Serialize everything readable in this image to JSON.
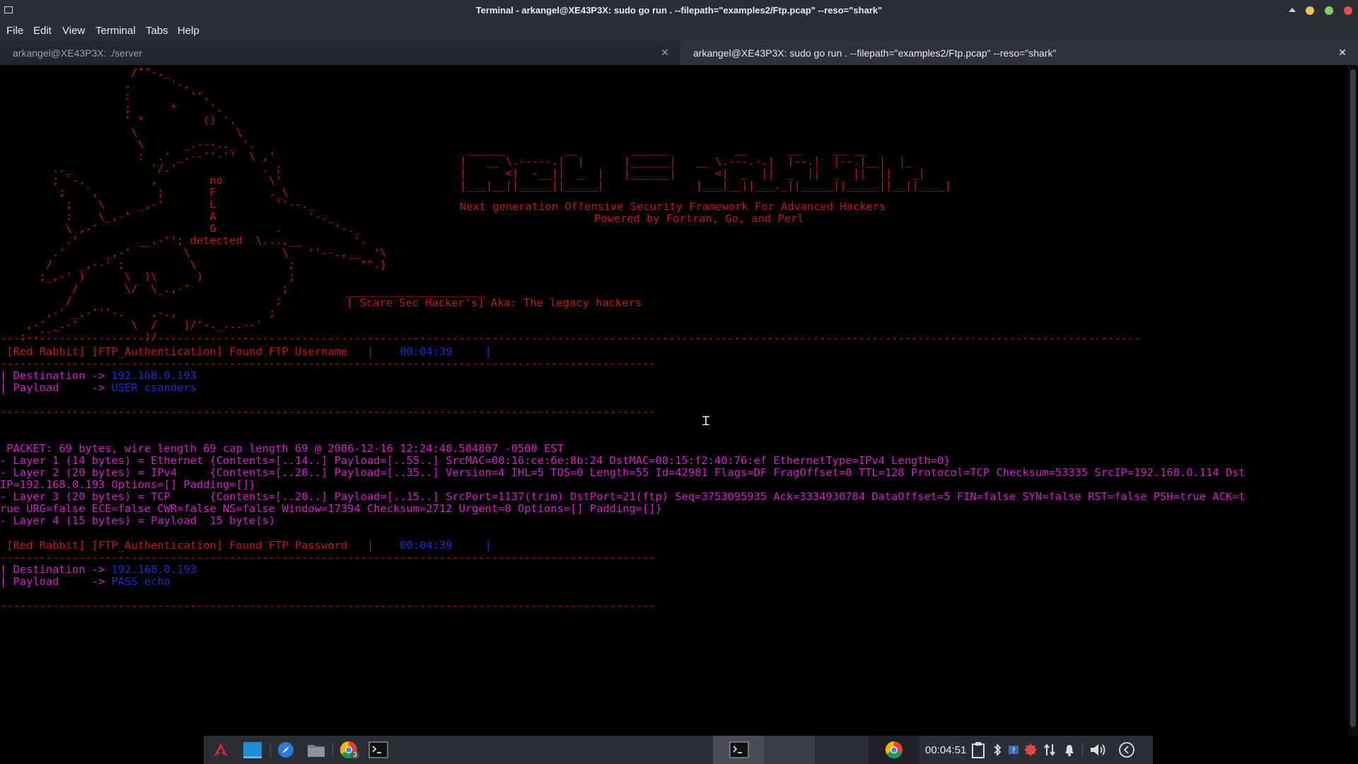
{
  "window": {
    "title": "Terminal - arkangel@XE43P3X: sudo go run . --filepath=\"examples2/Ftp.pcap\" --reso=\"shark\"",
    "controls": [
      "maximize-up-icon",
      "minimize-icon",
      "restore-icon",
      "close-icon"
    ],
    "colors": {
      "min": "#f5c14b",
      "max": "#7ad06b",
      "close": "#e35050"
    }
  },
  "menu": {
    "items": [
      "File",
      "Edit",
      "View",
      "Terminal",
      "Tabs",
      "Help"
    ]
  },
  "tabs": [
    {
      "label": "arkangel@XE43P3X: ./server",
      "active": false
    },
    {
      "label": "arkangel@XE43P3X: sudo go run . --filepath=\"examples2/Ftp.pcap\" --reso=\"shark\"",
      "active": true
    }
  ],
  "terminal": {
    "ascii_art": [
      "                    /\"\"-._",
      "                   .      '-,",
      "                   :         '',",
      "                   ;      *     '.",
      "                   ' *         () '.",
      "                    \\               \\",
      "                     \\      _.---.._ '.",
      "                     :  .' _.--''-''  \\ ,'",
      "        .._            '/.'             . ;",
      "        ; `-.          ,        no       \\'",
      "         ;   `,         ;       F        ._\\",
      "          ;    \\     _,-'       L         ''--._",
      "          :    \\_,-'            A              '-._",
      "          \\ ,-'                 G         .        '-._",
      "          .'         __.-''; detected  \\...,__        '.",
      "        .'      _,-'        \\              \\   ''--.,__  '\\",
      "       /    _,--' ;          \\              ;          \"^.}",
      "      ;_,-' )      \\  )\\      )             ;",
      "           /       \\/  \\_.,-'              ;",
      "          /                               ;",
      "       ,-' _,-'''-.    ,-.,              ;",
      "    ,-' _.-'        \\  /    |/'-._...--'",
      "   :--``              )/"
    ],
    "banner_logo": [
      " ______         __        ______          __      __     __ __",
      "|   __ \\.-----.|  |      |______|   __ \\.---.-.|  |--.|  |--.|__|  |_",
      "|      <|  -__||  _  |   |______|      <|  _  ||  _  ||  _  ||  ||   _|",
      "|___|__||_____||_____|              |___|__||___._||_____||_____||__||____|"
    ],
    "tagline": "Next generation Offensive Security Framework For Advanced Hackers",
    "powered": "Powered by Fortran, Go, and Perl",
    "credit_line": "_____________________",
    "credit": "[ Scare Sec Hacker's] Aka: The legacy hackers",
    "dashes_long": "------------------------------------------------------------------------------------------------------------------------------------------------------------------------------",
    "dashes_short": "----------------------------------------------------------------------------------------------------",
    "event1": {
      "head": " [Red Rabbit] [FTP_Authentication] Found FTP Username   |",
      "time": "00:04:39",
      "tail": "     |",
      "dest_label": "| Destination -> ",
      "dest": "192.168.0.193",
      "payload_label": "| Payload     -> ",
      "payload": "USER csanders"
    },
    "packet": [
      " PACKET: 69 bytes, wire length 69 cap length 69 @ 2006-12-16 12:24:40.504807 -0500 EST",
      "- Layer 1 (14 bytes) = Ethernet {Contents=[..14..] Payload=[..55..] SrcMAC=00:16:ce:6e:8b:24 DstMAC=00:15:f2:40:76:ef EthernetType=IPv4 Length=0}",
      "- Layer 2 (20 bytes) = IPv4     {Contents=[..20..] Payload=[..35..] Version=4 IHL=5 TOS=0 Length=55 Id=42981 Flags=DF FragOffset=0 TTL=128 Protocol=TCP Checksum=53335 SrcIP=192.168.0.114 Dst",
      "IP=192.168.0.193 Options=[] Padding=[]}",
      "- Layer 3 (20 bytes) = TCP      {Contents=[..20..] Payload=[..15..] SrcPort=1137(trim) DstPort=21(ftp) Seq=3753095935 Ack=3334930784 DataOffset=5 FIN=false SYN=false RST=false PSH=true ACK=t",
      "rue URG=false ECE=false CWR=false NS=false Window=17394 Checksum=2712 Urgent=0 Options=[] Padding=[]}",
      "- Layer 4 (15 bytes) = Payload  15 byte(s)"
    ],
    "event2": {
      "head": " [Red Rabbit] [FTP_Authentication] Found FTP Password   |",
      "time": "00:04:39",
      "tail": "     |",
      "dest_label": "| Destination -> ",
      "dest": "192.168.0.193",
      "payload_label": "| Payload     -> ",
      "payload": "PASS echo"
    },
    "colors": {
      "red": "#c01818",
      "blue": "#1a2ec8",
      "magenta": "#d020c8",
      "white": "#e8e8e8"
    }
  },
  "taskbar": {
    "launchers": [
      "arch-logo-icon",
      "desktop-icon",
      "browser-compass-icon",
      "folder-icon",
      "chrome-icon",
      "terminal-icon"
    ],
    "chrome_badge": "3",
    "clock": "00:04:51",
    "tray": [
      "clipboard-icon",
      "bluetooth-icon",
      "keyboard-icon",
      "bug-icon",
      "network-updown-icon",
      "bell-icon",
      "volume-icon",
      "back-arrow-icon"
    ]
  }
}
